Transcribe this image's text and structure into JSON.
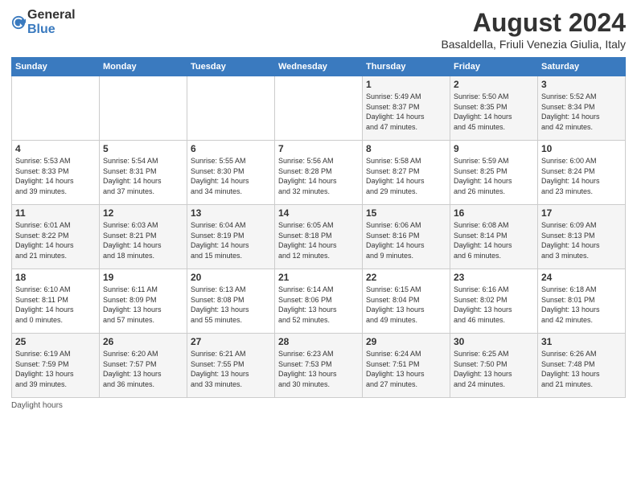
{
  "logo": {
    "general": "General",
    "blue": "Blue"
  },
  "title": "August 2024",
  "subtitle": "Basaldella, Friuli Venezia Giulia, Italy",
  "days_of_week": [
    "Sunday",
    "Monday",
    "Tuesday",
    "Wednesday",
    "Thursday",
    "Friday",
    "Saturday"
  ],
  "weeks": [
    [
      {
        "day": "",
        "info": ""
      },
      {
        "day": "",
        "info": ""
      },
      {
        "day": "",
        "info": ""
      },
      {
        "day": "",
        "info": ""
      },
      {
        "day": "1",
        "info": "Sunrise: 5:49 AM\nSunset: 8:37 PM\nDaylight: 14 hours\nand 47 minutes."
      },
      {
        "day": "2",
        "info": "Sunrise: 5:50 AM\nSunset: 8:35 PM\nDaylight: 14 hours\nand 45 minutes."
      },
      {
        "day": "3",
        "info": "Sunrise: 5:52 AM\nSunset: 8:34 PM\nDaylight: 14 hours\nand 42 minutes."
      }
    ],
    [
      {
        "day": "4",
        "info": "Sunrise: 5:53 AM\nSunset: 8:33 PM\nDaylight: 14 hours\nand 39 minutes."
      },
      {
        "day": "5",
        "info": "Sunrise: 5:54 AM\nSunset: 8:31 PM\nDaylight: 14 hours\nand 37 minutes."
      },
      {
        "day": "6",
        "info": "Sunrise: 5:55 AM\nSunset: 8:30 PM\nDaylight: 14 hours\nand 34 minutes."
      },
      {
        "day": "7",
        "info": "Sunrise: 5:56 AM\nSunset: 8:28 PM\nDaylight: 14 hours\nand 32 minutes."
      },
      {
        "day": "8",
        "info": "Sunrise: 5:58 AM\nSunset: 8:27 PM\nDaylight: 14 hours\nand 29 minutes."
      },
      {
        "day": "9",
        "info": "Sunrise: 5:59 AM\nSunset: 8:25 PM\nDaylight: 14 hours\nand 26 minutes."
      },
      {
        "day": "10",
        "info": "Sunrise: 6:00 AM\nSunset: 8:24 PM\nDaylight: 14 hours\nand 23 minutes."
      }
    ],
    [
      {
        "day": "11",
        "info": "Sunrise: 6:01 AM\nSunset: 8:22 PM\nDaylight: 14 hours\nand 21 minutes."
      },
      {
        "day": "12",
        "info": "Sunrise: 6:03 AM\nSunset: 8:21 PM\nDaylight: 14 hours\nand 18 minutes."
      },
      {
        "day": "13",
        "info": "Sunrise: 6:04 AM\nSunset: 8:19 PM\nDaylight: 14 hours\nand 15 minutes."
      },
      {
        "day": "14",
        "info": "Sunrise: 6:05 AM\nSunset: 8:18 PM\nDaylight: 14 hours\nand 12 minutes."
      },
      {
        "day": "15",
        "info": "Sunrise: 6:06 AM\nSunset: 8:16 PM\nDaylight: 14 hours\nand 9 minutes."
      },
      {
        "day": "16",
        "info": "Sunrise: 6:08 AM\nSunset: 8:14 PM\nDaylight: 14 hours\nand 6 minutes."
      },
      {
        "day": "17",
        "info": "Sunrise: 6:09 AM\nSunset: 8:13 PM\nDaylight: 14 hours\nand 3 minutes."
      }
    ],
    [
      {
        "day": "18",
        "info": "Sunrise: 6:10 AM\nSunset: 8:11 PM\nDaylight: 14 hours\nand 0 minutes."
      },
      {
        "day": "19",
        "info": "Sunrise: 6:11 AM\nSunset: 8:09 PM\nDaylight: 13 hours\nand 57 minutes."
      },
      {
        "day": "20",
        "info": "Sunrise: 6:13 AM\nSunset: 8:08 PM\nDaylight: 13 hours\nand 55 minutes."
      },
      {
        "day": "21",
        "info": "Sunrise: 6:14 AM\nSunset: 8:06 PM\nDaylight: 13 hours\nand 52 minutes."
      },
      {
        "day": "22",
        "info": "Sunrise: 6:15 AM\nSunset: 8:04 PM\nDaylight: 13 hours\nand 49 minutes."
      },
      {
        "day": "23",
        "info": "Sunrise: 6:16 AM\nSunset: 8:02 PM\nDaylight: 13 hours\nand 46 minutes."
      },
      {
        "day": "24",
        "info": "Sunrise: 6:18 AM\nSunset: 8:01 PM\nDaylight: 13 hours\nand 42 minutes."
      }
    ],
    [
      {
        "day": "25",
        "info": "Sunrise: 6:19 AM\nSunset: 7:59 PM\nDaylight: 13 hours\nand 39 minutes."
      },
      {
        "day": "26",
        "info": "Sunrise: 6:20 AM\nSunset: 7:57 PM\nDaylight: 13 hours\nand 36 minutes."
      },
      {
        "day": "27",
        "info": "Sunrise: 6:21 AM\nSunset: 7:55 PM\nDaylight: 13 hours\nand 33 minutes."
      },
      {
        "day": "28",
        "info": "Sunrise: 6:23 AM\nSunset: 7:53 PM\nDaylight: 13 hours\nand 30 minutes."
      },
      {
        "day": "29",
        "info": "Sunrise: 6:24 AM\nSunset: 7:51 PM\nDaylight: 13 hours\nand 27 minutes."
      },
      {
        "day": "30",
        "info": "Sunrise: 6:25 AM\nSunset: 7:50 PM\nDaylight: 13 hours\nand 24 minutes."
      },
      {
        "day": "31",
        "info": "Sunrise: 6:26 AM\nSunset: 7:48 PM\nDaylight: 13 hours\nand 21 minutes."
      }
    ]
  ],
  "footer": "Daylight hours"
}
